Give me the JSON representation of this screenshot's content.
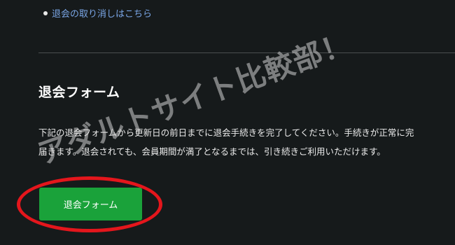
{
  "cancel_link": {
    "label": "退会の取り消しはこちら"
  },
  "section": {
    "title": "退会フォーム",
    "description_lines": [
      "下記の退会フォームから更新日の前日までに退会手続きを完了してください。手続きが正常に完",
      "届きます。退会されても、会員期間が満了となるまでは、引き続きご利用いただけます。"
    ]
  },
  "form_button": {
    "label": "退会フォーム"
  },
  "watermark": {
    "text": "アダルトサイト比較部！"
  },
  "colors": {
    "background": "#161a1b",
    "link": "#7aa6e6",
    "button": "#1aa23a",
    "highlight": "#e4161c"
  }
}
